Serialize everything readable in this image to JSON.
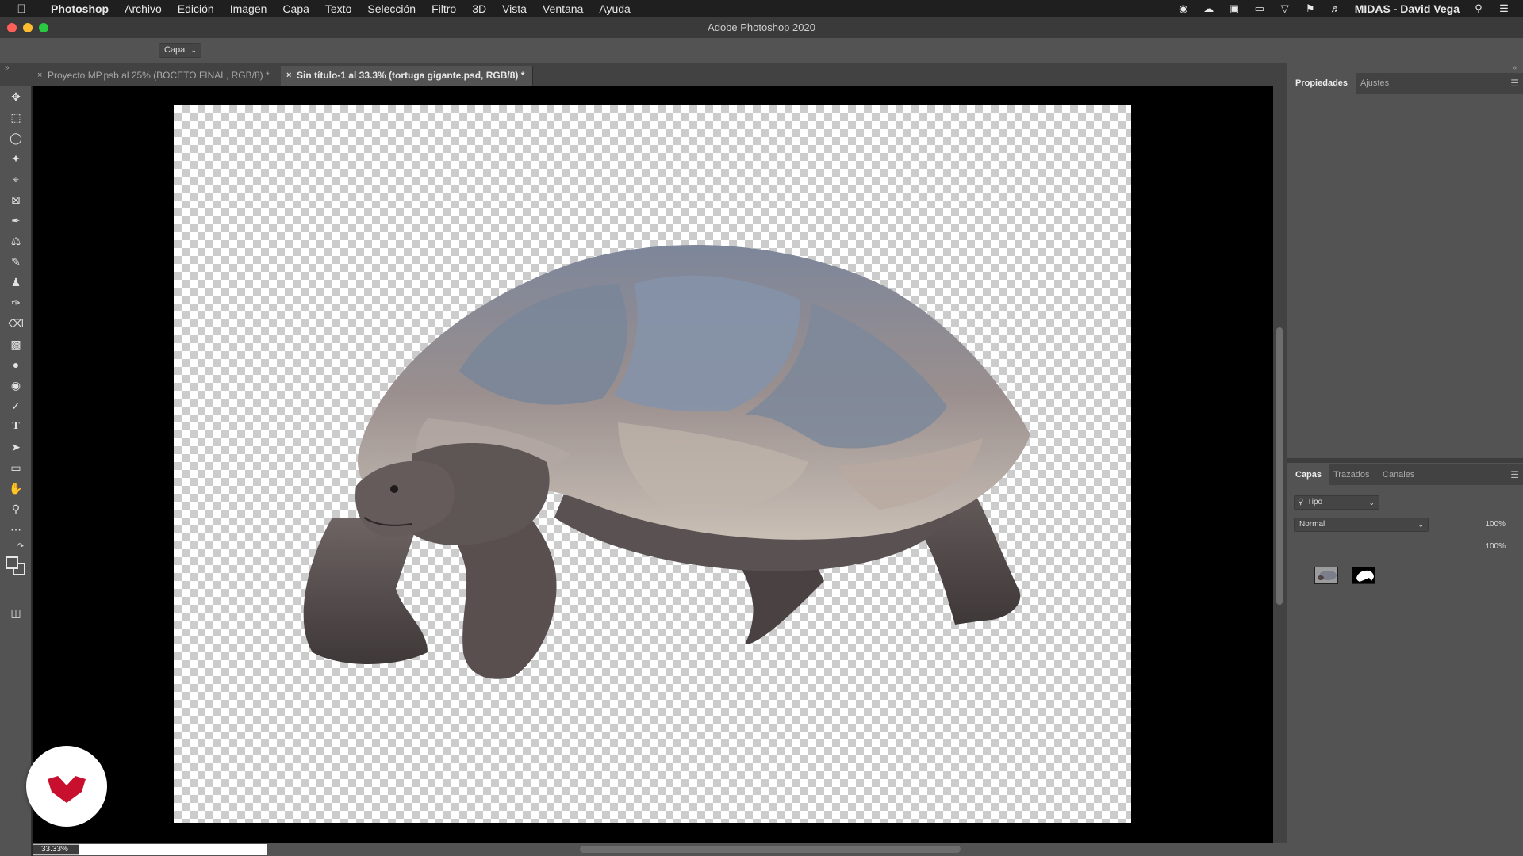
{
  "menubar": {
    "app_name": "Photoshop",
    "items": [
      "Archivo",
      "Edición",
      "Imagen",
      "Capa",
      "Texto",
      "Selección",
      "Filtro",
      "3D",
      "Vista",
      "Ventana",
      "Ayuda"
    ],
    "user": "MIDAS - David Vega"
  },
  "window": {
    "title": "Adobe Photoshop 2020"
  },
  "options_bar": {
    "select_value": "Capa"
  },
  "tabs": [
    {
      "label": "Proyecto MP.psb al 25% (BOCETO FINAL, RGB/8) *"
    },
    {
      "label": "Sin título-1 al 33.3% (tortuga gigante.psd, RGB/8) *"
    }
  ],
  "status": {
    "zoom": "33.33%"
  },
  "panels": {
    "top_tabs": [
      "Propiedades",
      "Ajustes"
    ],
    "layers_tabs": [
      "Capas",
      "Trazados",
      "Canales"
    ],
    "filter_label": "Tipo",
    "blend_mode": "Normal",
    "opacity": "100%",
    "fill": "100%"
  },
  "colors": {
    "accent_red": "#c8102e",
    "close": "#fe5f57",
    "minimize": "#febc2e",
    "zoom": "#28c840"
  }
}
